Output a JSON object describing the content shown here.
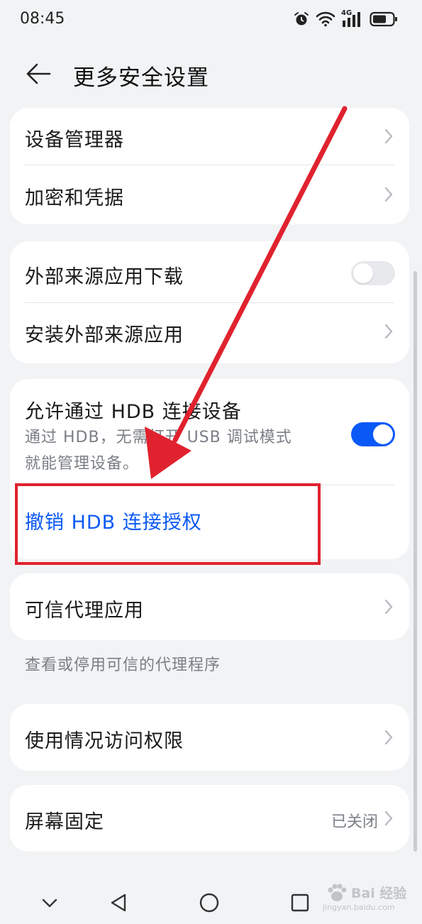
{
  "status": {
    "time": "08:45",
    "network": "4G"
  },
  "header": {
    "title": "更多安全设置"
  },
  "group1": {
    "device_manager": "设备管理器",
    "encryption": "加密和凭据"
  },
  "group2": {
    "external_download": "外部来源应用下载",
    "install_external": "安装外部来源应用"
  },
  "group3": {
    "hdb_title": "允许通过 HDB 连接设备",
    "hdb_desc_line1": "通过 HDB，无需打开 USB 调试模式",
    "hdb_desc_line2": "就能管理设备。",
    "revoke": "撤销 HDB 连接授权"
  },
  "group4": {
    "trust_agent": "可信代理应用",
    "trust_agent_note": "查看或停用可信的代理程序"
  },
  "group5": {
    "usage_access": "使用情况访问权限"
  },
  "group6": {
    "screen_pin": "屏幕固定",
    "screen_pin_value": "已关闭"
  },
  "toggles": {
    "external_download_on": false,
    "hdb_on": true
  },
  "watermark": {
    "text": "Bai 经验",
    "sub": "jingyan.baidu.com"
  },
  "colors": {
    "accent": "#0a59f7",
    "annotation": "#e0222e",
    "background": "#f1f3f5"
  }
}
